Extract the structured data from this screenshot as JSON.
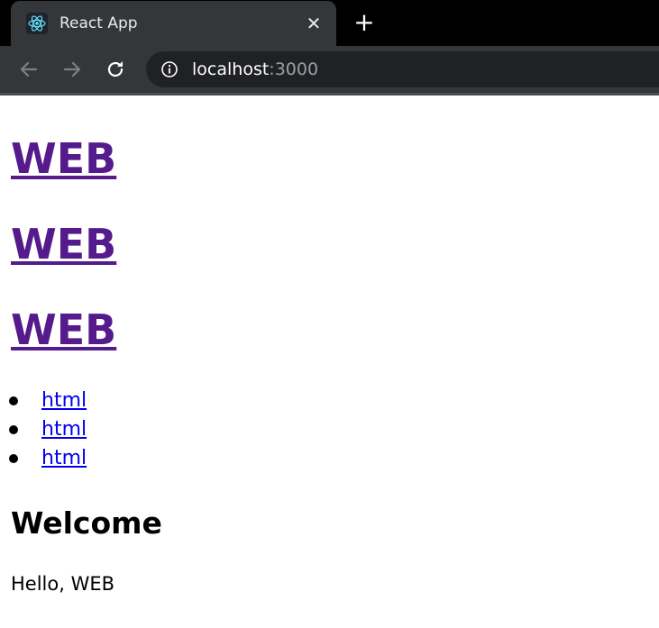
{
  "browser": {
    "tab_title": "React App",
    "tab_close_glyph": "✕",
    "new_tab_glyph": "+",
    "url_host": "localhost",
    "url_port": ":3000",
    "icons": {
      "favicon": "react-logo-icon",
      "back": "arrow-left-icon",
      "forward": "arrow-right-icon",
      "reload": "reload-icon",
      "site_info": "info-icon"
    },
    "colors": {
      "tabstrip": "#000000",
      "toolbar": "#35363a",
      "omnibox": "#202124",
      "react_logo": "#61dafb"
    }
  },
  "page": {
    "headings": [
      "WEB",
      "WEB",
      "WEB"
    ],
    "nav_items": [
      "html",
      "html",
      "html"
    ],
    "article": {
      "title": "Welcome",
      "body": "Hello, WEB"
    },
    "colors": {
      "visited_link": "#551a8b",
      "link": "#0000ee",
      "text": "#000000"
    }
  }
}
